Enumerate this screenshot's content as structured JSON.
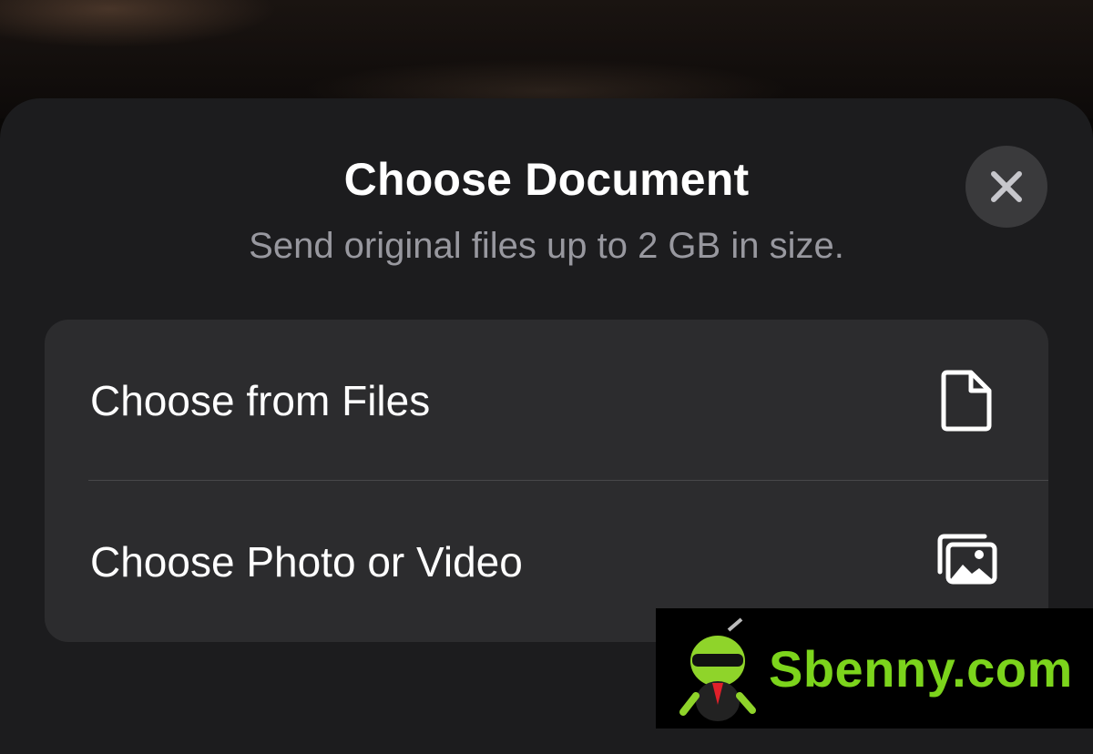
{
  "sheet": {
    "title": "Choose Document",
    "subtitle": "Send original files up to 2 GB in size.",
    "close_icon": "xmark-icon"
  },
  "options": [
    {
      "label": "Choose from Files",
      "icon": "document-icon"
    },
    {
      "label": "Choose Photo or Video",
      "icon": "photos-icon"
    }
  ],
  "watermark": {
    "text": "Sbenny.com",
    "color": "#7cd41c"
  },
  "colors": {
    "sheet_background": "#1c1c1e",
    "card_background": "#2c2c2e",
    "subtitle": "#98989f",
    "close_button": "#3a3a3c"
  }
}
